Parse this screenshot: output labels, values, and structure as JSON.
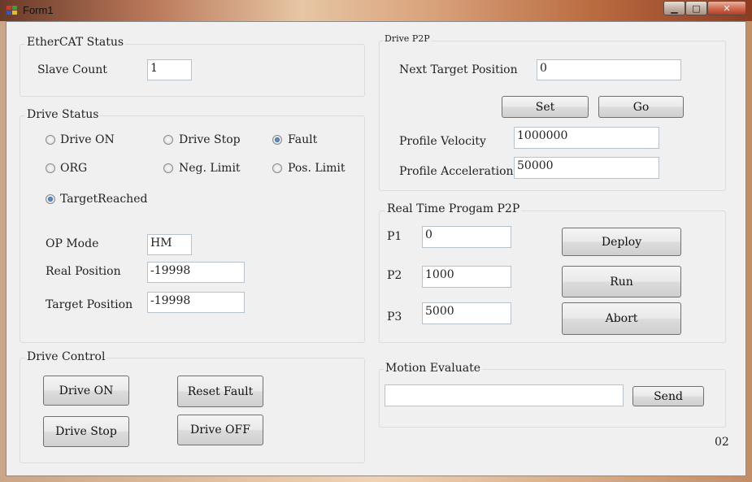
{
  "window": {
    "title": "Form1"
  },
  "ethercat": {
    "title": "EtherCAT Status",
    "slave_count_label": "Slave Count",
    "slave_count": "1"
  },
  "drive_status": {
    "title": "Drive Status",
    "radios": [
      {
        "label": "Drive ON",
        "checked": false
      },
      {
        "label": "Drive Stop",
        "checked": false
      },
      {
        "label": "Fault",
        "checked": true
      },
      {
        "label": "ORG",
        "checked": false
      },
      {
        "label": "Neg. Limit",
        "checked": false
      },
      {
        "label": "Pos. Limit",
        "checked": false
      },
      {
        "label": "TargetReached",
        "checked": true
      }
    ],
    "op_mode_label": "OP Mode",
    "op_mode": "HM",
    "real_position_label": "Real Position",
    "real_position": "-19998",
    "target_position_label": "Target Position",
    "target_position": "-19998"
  },
  "drive_control": {
    "title": "Drive Control",
    "drive_on": "Drive ON",
    "reset_fault": "Reset Fault",
    "drive_stop": "Drive Stop",
    "drive_off": "Drive OFF"
  },
  "drive_p2p": {
    "title": "Drive P2P",
    "next_target_label": "Next Target Position",
    "next_target": "0",
    "set": "Set",
    "go": "Go",
    "profile_velocity_label": "Profile Velocity",
    "profile_velocity": "1000000",
    "profile_acceleration_label": "Profile Acceleration",
    "profile_acceleration": "50000"
  },
  "rt_program": {
    "title": "Real Time Progam P2P",
    "p1_label": "P1",
    "p1": "0",
    "p2_label": "P2",
    "p2": "1000",
    "p3_label": "P3",
    "p3": "5000",
    "deploy": "Deploy",
    "run": "Run",
    "abort": "Abort"
  },
  "motion": {
    "title": "Motion Evaluate",
    "input": "",
    "send": "Send"
  },
  "footer": {
    "code": "02"
  }
}
